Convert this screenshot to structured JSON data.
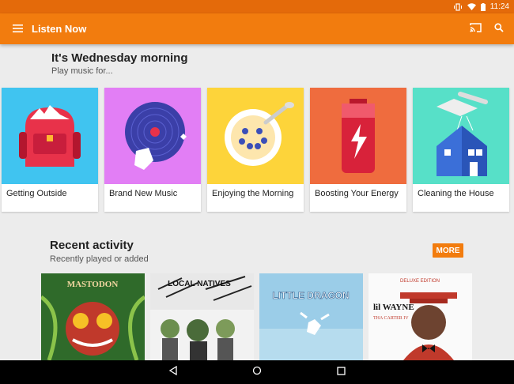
{
  "status_bar": {
    "time": "11:24",
    "icons": [
      "vibrate-icon",
      "wifi-icon",
      "battery-icon"
    ]
  },
  "app_bar": {
    "title": "Listen Now",
    "icons": [
      "menu-icon",
      "cast-icon",
      "search-icon"
    ]
  },
  "greeting": {
    "heading": "It's Wednesday morning",
    "subheading": "Play music for..."
  },
  "cards": [
    {
      "label": "Getting Outside",
      "art_color": "#40c4f0",
      "icon": "backpack-icon"
    },
    {
      "label": "Brand New Music",
      "art_color": "#e27ef5",
      "icon": "vinyl-record-icon"
    },
    {
      "label": "Enjoying the Morning",
      "art_color": "#fdd43a",
      "icon": "cereal-bowl-icon"
    },
    {
      "label": "Boosting Your Energy",
      "art_color": "#ef6c3e",
      "icon": "battery-charge-icon"
    },
    {
      "label": "Cleaning the House",
      "art_color": "#57e0c8",
      "icon": "vacuum-house-icon"
    }
  ],
  "recent": {
    "heading": "Recent activity",
    "subheading": "Recently played or added",
    "more_label": "MORE"
  },
  "albums": [
    {
      "art_text": "MASTODON",
      "icon": "album-art-mastodon"
    },
    {
      "art_text": "LOCAL NATIVES",
      "icon": "album-art-local-natives"
    },
    {
      "art_text": "LITTLE DRAGON",
      "icon": "album-art-little-dragon"
    },
    {
      "art_text": "lil WAYNE",
      "art_subtext": "THA CARTER IV",
      "art_edition": "DELUXE EDITION",
      "icon": "album-art-lil-wayne"
    }
  ],
  "colors": {
    "status_bar": "#e46a0a",
    "app_bar": "#f27c0e",
    "background": "#ececec",
    "accent": "#f27c0e"
  },
  "nav_bar": {
    "icons": [
      "back-icon",
      "home-icon",
      "recents-icon"
    ]
  }
}
